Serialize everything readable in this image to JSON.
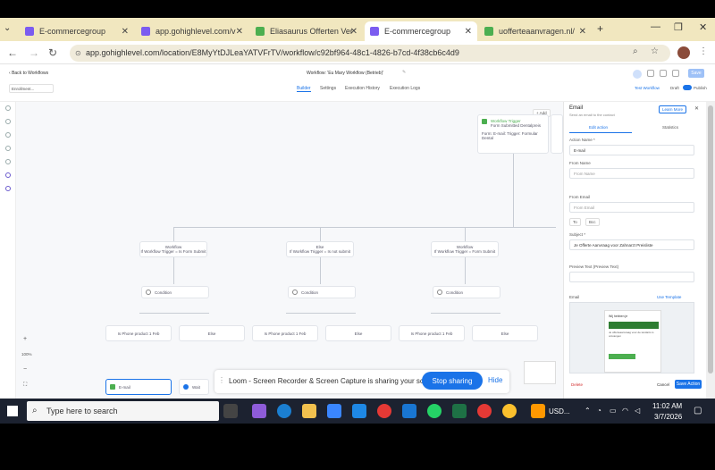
{
  "browser": {
    "tabs": [
      {
        "label": "E-commercegroup",
        "active": false,
        "color": "#7b5cf0"
      },
      {
        "label": "app.gohighlevel.com/v2/",
        "active": false,
        "color": "#7b5cf0"
      },
      {
        "label": "Eliasaurus Offerten Vergl.",
        "active": false,
        "color": "#4caf50"
      },
      {
        "label": "E-commercegroup",
        "active": true,
        "color": "#7b5cf0"
      },
      {
        "label": "uofferteaanvragen.nl/",
        "active": false,
        "color": "#4caf50"
      }
    ],
    "url": "app.gohighlevel.com/location/E8MyYtDJLeaYATVFrTV/workflow/c92bf964-48c1-4826-b7cd-4f38cb6c4d9"
  },
  "app": {
    "back_label": "Back to Workflows",
    "workflow_title": "Workflow: 'Eu Mary Workflow (Betrieb)'",
    "nav_tabs": [
      "Builder",
      "Settings",
      "Execution History",
      "Execution Logs"
    ],
    "left_select": "Enrollment...",
    "toggle_label": "Draft",
    "publish_label": "Publish",
    "test_label": "Test Workflow",
    "save_label": "Save"
  },
  "canvas": {
    "trigger_title": "Workflow Trigger",
    "trigger_sub": "Form Submitted Dentalpreis",
    "trigger_detail": "Form: E-mail: Trigger: Formular Dental",
    "add_trigger": "+ Add",
    "branches": [
      {
        "title": "Workflow",
        "sub": "If Workflow Trigger = Is Form Submit",
        "cond": "Condition"
      },
      {
        "title": "Else",
        "sub": "If Workflow Trigger = Is not submit",
        "cond": "Condition"
      },
      {
        "title": "Workflow",
        "sub": "If Workflow Trigger = Form Submit",
        "cond": "Condition"
      }
    ],
    "sub_nodes": [
      "Is Phone product 1 Feb",
      "Else",
      "Is Phone product 1 Feb",
      "Else",
      "Is Phone product 1 Feb",
      "Else"
    ],
    "bottom_left": "E-mail",
    "bottom_mid": "Wait",
    "zoom": "100%"
  },
  "panel": {
    "title": "Email",
    "subtitle": "Send an email to the contact",
    "learn_more": "Learn More",
    "tabs": [
      "Edit action",
      "Statistics"
    ],
    "action_name_label": "Action Name *",
    "action_name_value": "E-mail",
    "from_name_label": "From Name",
    "from_name_placeholder": "From Name",
    "from_email_label": "From Email",
    "from_email_placeholder": "From Email",
    "to_label": "To",
    "bcc_label": "Bcc",
    "subject_label": "Subject *",
    "subject_value": "Je Offerte Aanvraag voor Zahnarzt Preisliste",
    "preview_label": "Preview Text (Preview Text)",
    "email_label": "Email",
    "use_template": "Use Template",
    "delete_label": "Delete",
    "cancel_label": "Cancel",
    "save_action": "Save Action",
    "template_heading": "Wij hebben je",
    "template_text": "Je offerteaanvraag voor de tandarts is ontvangen"
  },
  "loom": {
    "message": "Loom - Screen Recorder & Screen Capture is sharing your screen.",
    "stop_label": "Stop sharing",
    "hide_label": "Hide"
  },
  "taskbar": {
    "search_placeholder": "Type here to search",
    "currency": "USD...",
    "time": "11:02 AM",
    "date": "3/7/2026"
  }
}
